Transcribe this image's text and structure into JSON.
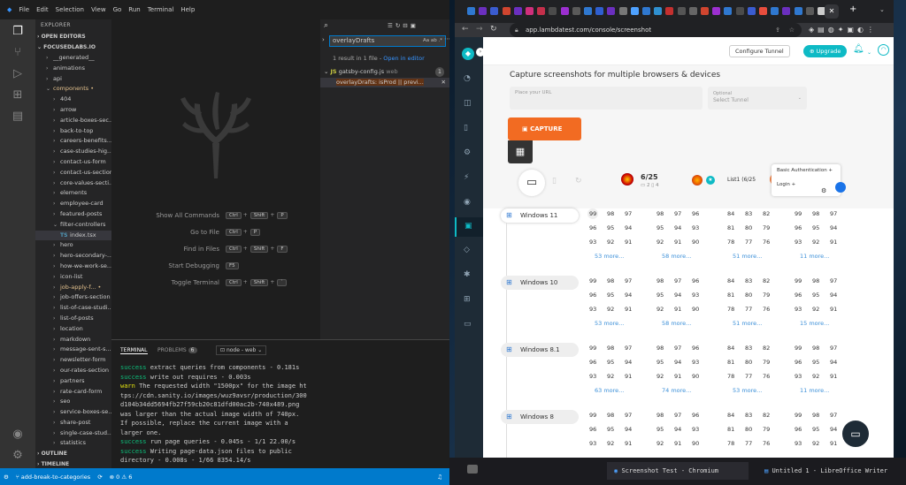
{
  "vscode": {
    "menu": [
      "File",
      "Edit",
      "Selection",
      "View",
      "Go",
      "Run",
      "Terminal",
      "Help"
    ],
    "explorer_title": "EXPLORER",
    "open_editors": "OPEN EDITORS",
    "project": "FOCUSEDLABS.IO",
    "tree": [
      "__generated__",
      "animations",
      "api",
      "components",
      "404",
      "arrow",
      "article-boxes-sec...",
      "back-to-top",
      "careers-benefits...",
      "case-studies-hig...",
      "contact-us-form",
      "contact-us-section",
      "core-values-secti...",
      "elements",
      "employee-card",
      "featured-posts",
      "filter-controllers",
      "index.tsx",
      "hero",
      "hero-secondary-...",
      "how-we-work-se...",
      "icon-list",
      "job-apply-f...",
      "job-offers-section",
      "list-of-case-studi...",
      "list-of-posts",
      "location",
      "markdown",
      "message-sent-s...",
      "newsletter-form",
      "our-rates-section",
      "partners",
      "rate-card-form",
      "seo",
      "service-boxes-se...",
      "share-post",
      "single-case-stud...",
      "statistics"
    ],
    "outline": "OUTLINE",
    "timeline": "TIMELINE",
    "shortcuts": [
      {
        "label": "Show All Commands",
        "keys": [
          "Ctrl",
          "+",
          "Shift",
          "+",
          "P"
        ]
      },
      {
        "label": "Go to File",
        "keys": [
          "Ctrl",
          "+",
          "P"
        ]
      },
      {
        "label": "Find in Files",
        "keys": [
          "Ctrl",
          "+",
          "Shift",
          "+",
          "F"
        ]
      },
      {
        "label": "Start Debugging",
        "keys": [
          "F5"
        ]
      },
      {
        "label": "Toggle Terminal",
        "keys": [
          "Ctrl",
          "+",
          "Shift",
          "+",
          "`"
        ]
      }
    ],
    "search": {
      "query": "overlayDrafts",
      "options": "Aa ab .*",
      "results_summary": "1 result in 1 file -",
      "open_in_editor": "Open in editor",
      "file": "gatsby-config.js",
      "file_dir": "web",
      "count": "1",
      "match_text": "overlayDrafts: isProd || previ..."
    },
    "panel": {
      "tab_terminal": "TERMINAL",
      "tab_problems": "PROBLEMS",
      "problems_count": "6",
      "terminal_select": "node - web",
      "lines": [
        {
          "kind": "ok",
          "pre": "success",
          "text": " extract queries from components - 0.181s"
        },
        {
          "kind": "ok",
          "pre": "success",
          "text": " write out requires - 0.003s"
        },
        {
          "kind": "warn",
          "pre": "warn",
          "text": " The requested width \"1500px\" for the image ht"
        },
        {
          "kind": "plain",
          "pre": "",
          "text": "tps://cdn.sanity.io/images/wuz9avsr/production/300"
        },
        {
          "kind": "plain",
          "pre": "",
          "text": "d104b34dd5694fb27f59cb20c81dfd00ac2b-740x489.png"
        },
        {
          "kind": "plain",
          "pre": "",
          "text": "was larger than the actual image width of 740px."
        },
        {
          "kind": "plain",
          "pre": "",
          "text": "If possible, replace the current image with a"
        },
        {
          "kind": "plain",
          "pre": "",
          "text": "larger one."
        },
        {
          "kind": "ok",
          "pre": "success",
          "text": " run page queries - 0.045s - 1/1 22.00/s"
        },
        {
          "kind": "ok",
          "pre": "success",
          "text": " Writing page-data.json files to public"
        },
        {
          "kind": "plain",
          "pre": "",
          "text": "directory - 0.008s - 1/66 8354.14/s"
        }
      ]
    },
    "status": {
      "branch": "add-break-to-categories",
      "problems": "⊗ 0 ⚠ 6"
    }
  },
  "chrome": {
    "url": "app.lambdatest.com/console/screenshot",
    "configure_tunnel": "Configure Tunnel",
    "upgrade": "Upgrade",
    "heading": "Capture screenshots for multiple browsers & devices",
    "url_placeholder": "Place your URL",
    "tunnel_label": "Optional",
    "tunnel_placeholder": "Select Tunnel",
    "capture": "CAPTURE",
    "count": "6/25",
    "count_sub_a": "2",
    "count_sub_b": "4",
    "list_label": "List1",
    "list_count": "(6/25",
    "basic_auth": "Basic Authentication",
    "login": "Login",
    "os_rows": [
      {
        "os": "Windows 11",
        "mores": [
          "53 more...",
          "58 more...",
          "51 more...",
          "11 more..."
        ]
      },
      {
        "os": "Windows 10",
        "mores": [
          "53 more...",
          "58 more...",
          "51 more...",
          "15 more..."
        ]
      },
      {
        "os": "Windows 8.1",
        "mores": [
          "63 more...",
          "74 more...",
          "53 more...",
          "11 more..."
        ]
      },
      {
        "os": "Windows 8",
        "mores": []
      }
    ],
    "versions": [
      [
        "99",
        "98",
        "97"
      ],
      [
        "96",
        "95",
        "94"
      ],
      [
        "93",
        "92",
        "91"
      ]
    ],
    "versions_b": [
      [
        "98",
        "97",
        "96"
      ],
      [
        "95",
        "94",
        "93"
      ],
      [
        "92",
        "91",
        "90"
      ]
    ],
    "versions_c": [
      [
        "84",
        "83",
        "82"
      ],
      [
        "81",
        "80",
        "79"
      ],
      [
        "78",
        "77",
        "76"
      ]
    ]
  },
  "taskbar": {
    "chromium": "Screenshot Test - Chromium",
    "writer": "Untitled 1 - LibreOffice Writer"
  }
}
